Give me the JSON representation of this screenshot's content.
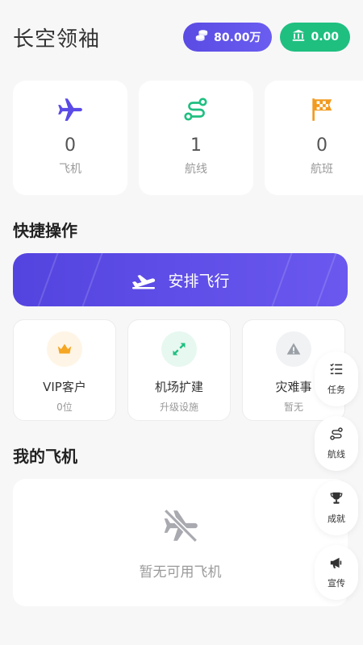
{
  "header": {
    "title": "长空领袖",
    "coins": {
      "value": "80.00万",
      "icon": "coins-icon"
    },
    "bank": {
      "value": "0.00",
      "icon": "bank-icon"
    }
  },
  "stats": [
    {
      "icon": "airplane-icon",
      "value": "0",
      "label": "飞机",
      "color": "#5b4be6"
    },
    {
      "icon": "route-icon",
      "value": "1",
      "label": "航线",
      "color": "#1fbf80"
    },
    {
      "icon": "checkered-flag-icon",
      "value": "0",
      "label": "航班",
      "color": "#f29a1f"
    }
  ],
  "quick_actions": {
    "title": "快捷操作",
    "primary_label": "安排飞行",
    "primary_icon": "takeoff-icon"
  },
  "features": [
    {
      "icon": "crown-icon",
      "title": "VIP客户",
      "subtitle": "0位",
      "color": "#f5a623",
      "bg": "#fff5e6"
    },
    {
      "icon": "expand-icon",
      "title": "机场扩建",
      "subtitle": "升级设施",
      "color": "#1fbf80",
      "bg": "#e7f8f0"
    },
    {
      "icon": "warning-icon",
      "title": "灾难事",
      "subtitle": "暂无",
      "color": "#9aa0a6",
      "bg": "#f1f2f4"
    }
  ],
  "my_planes": {
    "title": "我的飞机",
    "empty_text": "暂无可用飞机",
    "empty_icon": "plane-slash-icon"
  },
  "side_nav": [
    {
      "icon": "tasks-icon",
      "label": "任务"
    },
    {
      "icon": "route-icon",
      "label": "航线"
    },
    {
      "icon": "trophy-icon",
      "label": "成就"
    },
    {
      "icon": "megaphone-icon",
      "label": "宣传"
    }
  ],
  "colors": {
    "brand": "#5b4be6",
    "green": "#1fbf80",
    "orange": "#f29a1f"
  }
}
